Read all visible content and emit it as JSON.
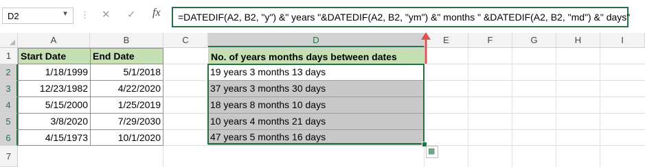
{
  "name_box": {
    "value": "D2"
  },
  "formula_bar": {
    "fx_label": "fx",
    "cancel": "✕",
    "enter": "✓",
    "formula": "=DATEDIF(A2, B2, \"y\") &\" years \"&DATEDIF(A2, B2, \"ym\") &\" months \" &DATEDIF(A2, B2, \"md\") &\" days\""
  },
  "columns": [
    "A",
    "B",
    "C",
    "D",
    "E",
    "F",
    "G",
    "H",
    "I"
  ],
  "rows": [
    "1",
    "2",
    "3",
    "4",
    "5",
    "6",
    "7"
  ],
  "headers": {
    "a": "Start Date",
    "b": "End Date",
    "d": "No. of years months days between dates"
  },
  "start_dates": [
    "1/18/1999",
    "12/23/1982",
    "5/15/2000",
    "3/8/2020",
    "4/15/1973"
  ],
  "end_dates": [
    "5/1/2018",
    "4/22/2020",
    "1/25/2019",
    "7/29/2030",
    "10/1/2020"
  ],
  "results": [
    "19 years 3 months 13 days",
    "37 years 3 months 30 days",
    "18 years 8 months 10 days",
    "10 years 4 months 21 days",
    "47 years 5 months 16 days"
  ],
  "colors": {
    "header_fill": "#c5e0b3",
    "selection": "#217346",
    "result_fill": "#c8c8c8",
    "arrow": "#d9534f"
  }
}
